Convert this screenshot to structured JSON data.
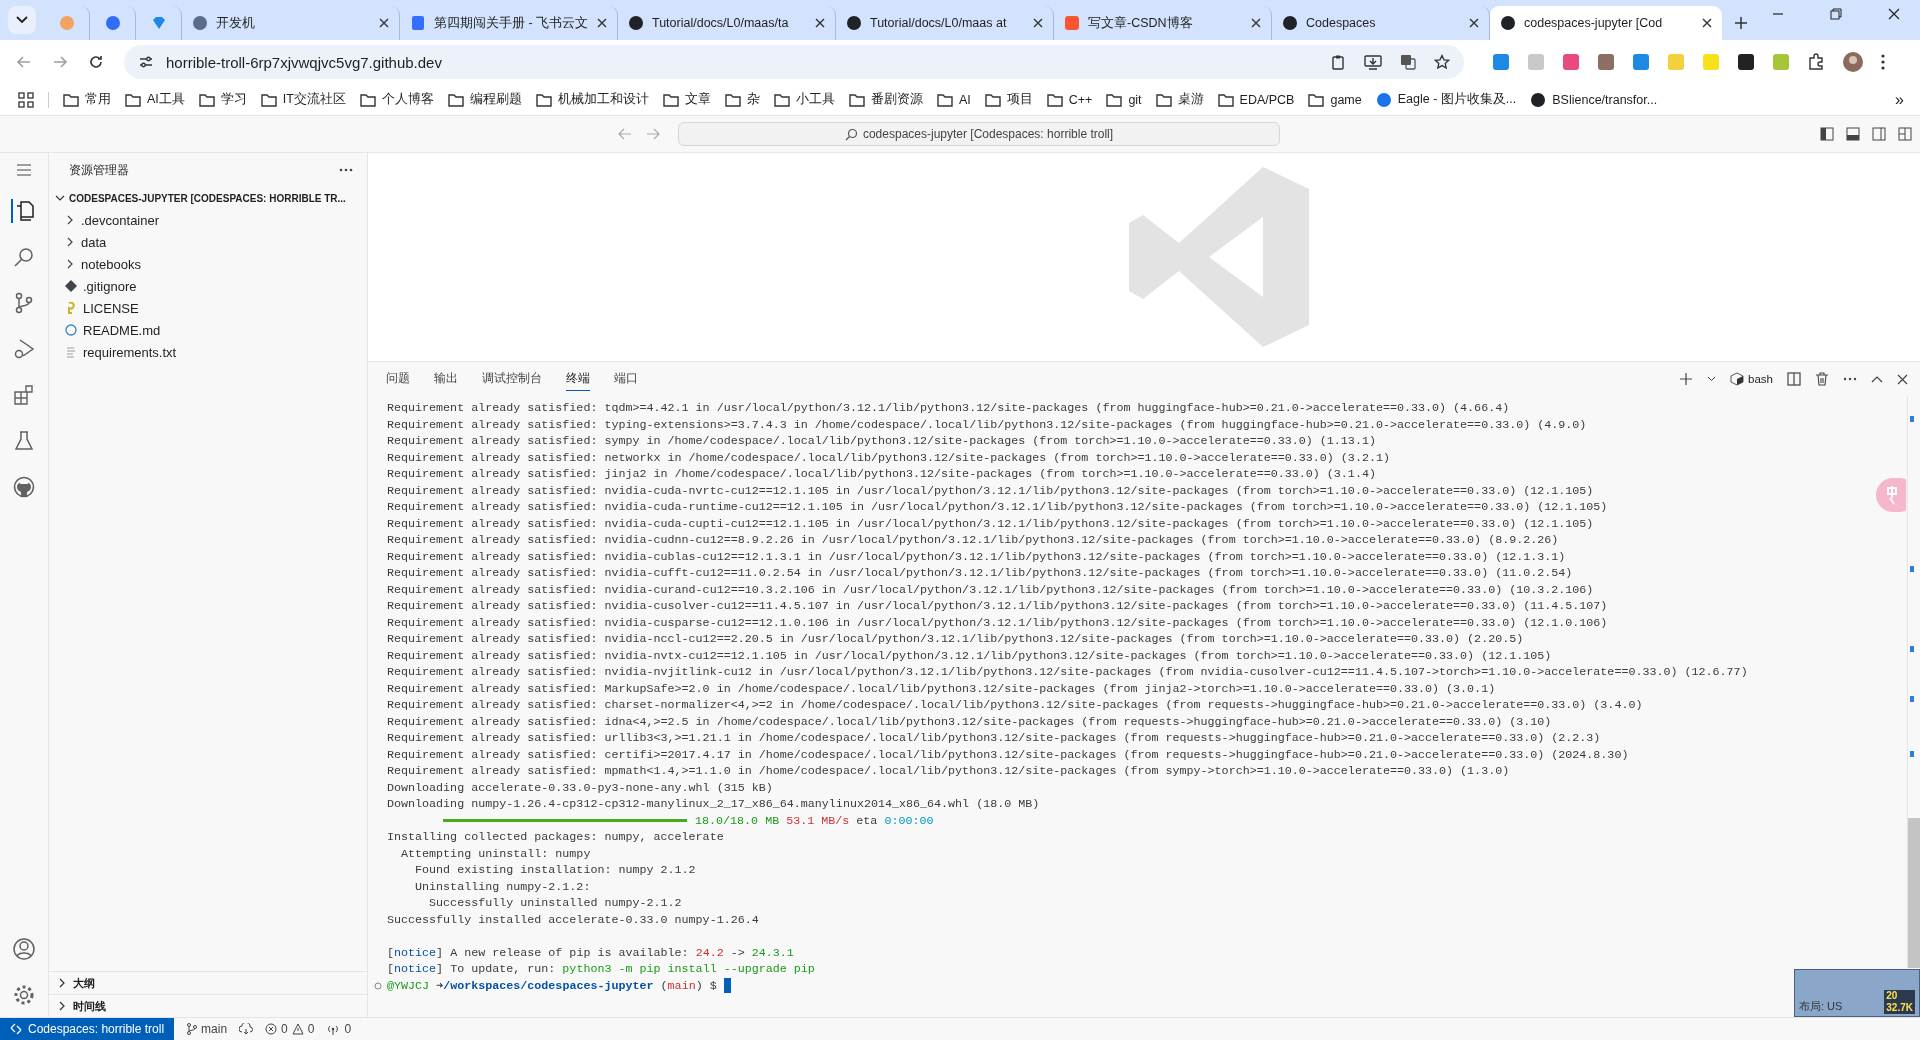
{
  "browser": {
    "tabs": [
      {
        "selected": false
      },
      {
        "selected": false
      },
      {
        "selected": false
      },
      {
        "title": "开发机",
        "selected": false
      },
      {
        "title": "第四期闯关手册 - 飞书云文",
        "selected": false
      },
      {
        "title": "Tutorial/docs/L0/maas/ta",
        "selected": false
      },
      {
        "title": "Tutorial/docs/L0/maas at",
        "selected": false
      },
      {
        "title": "写文章-CSDN博客",
        "selected": false
      },
      {
        "title": "Codespaces",
        "selected": false
      },
      {
        "title": "codespaces-jupyter [Cod",
        "selected": true
      }
    ],
    "address": "horrible-troll-6rp7xjvwqjvc5vg7.github.dev",
    "bookmarks": [
      {
        "kind": "folder",
        "label": "常用"
      },
      {
        "kind": "folder",
        "label": "AI工具"
      },
      {
        "kind": "folder",
        "label": "学习"
      },
      {
        "kind": "folder",
        "label": "IT交流社区"
      },
      {
        "kind": "folder",
        "label": "个人博客"
      },
      {
        "kind": "folder",
        "label": "编程刷题"
      },
      {
        "kind": "folder",
        "label": "机械加工和设计"
      },
      {
        "kind": "folder",
        "label": "文章"
      },
      {
        "kind": "folder",
        "label": "杂"
      },
      {
        "kind": "folder",
        "label": "小工具"
      },
      {
        "kind": "folder",
        "label": "番剧资源"
      },
      {
        "kind": "folder",
        "label": "AI"
      },
      {
        "kind": "folder",
        "label": "项目"
      },
      {
        "kind": "folder",
        "label": "C++"
      },
      {
        "kind": "folder",
        "label": "git"
      },
      {
        "kind": "folder",
        "label": "桌游"
      },
      {
        "kind": "folder",
        "label": "EDA/PCB"
      },
      {
        "kind": "folder",
        "label": "game"
      },
      {
        "kind": "link",
        "label": "Eagle - 图片收集及..."
      },
      {
        "kind": "link",
        "label": "BSlience/transfor..."
      }
    ],
    "more_bookmarks": "»"
  },
  "command_center": "codespaces-jupyter [Codespaces: horrible troll]",
  "sidebar": {
    "title": "资源管理器",
    "root": {
      "label": "CODESPACES-JUPYTER [CODESPACES: HORRIBLE TR...",
      "expanded": true,
      "children": [
        {
          "label": ".devcontainer",
          "kind": "folder",
          "expanded": false
        },
        {
          "label": "data",
          "kind": "folder",
          "expanded": false
        },
        {
          "label": "notebooks",
          "kind": "folder",
          "expanded": false
        },
        {
          "label": ".gitignore",
          "kind": "git"
        },
        {
          "label": "LICENSE",
          "kind": "license"
        },
        {
          "label": "README.md",
          "kind": "info"
        },
        {
          "label": "requirements.txt",
          "kind": "text"
        }
      ]
    },
    "sections": [
      {
        "label": "大纲",
        "expanded": false
      },
      {
        "label": "时间线",
        "expanded": false
      }
    ]
  },
  "panel": {
    "tabs": [
      {
        "label": "问题",
        "selected": false
      },
      {
        "label": "输出",
        "selected": false
      },
      {
        "label": "调试控制台",
        "selected": false
      },
      {
        "label": "终端",
        "selected": true
      },
      {
        "label": "端口",
        "selected": false
      }
    ],
    "shell": "bash",
    "lines": [
      {
        "kind": "plain",
        "text": "Requirement already satisfied: tqdm>=4.42.1 in /usr/local/python/3.12.1/lib/python3.12/site-packages (from huggingface-hub>=0.21.0->accelerate==0.33.0) (4.66.4)"
      },
      {
        "kind": "plain",
        "text": "Requirement already satisfied: typing-extensions>=3.7.4.3 in /home/codespace/.local/lib/python3.12/site-packages (from huggingface-hub>=0.21.0->accelerate==0.33.0) (4.9.0)"
      },
      {
        "kind": "plain",
        "text": "Requirement already satisfied: sympy in /home/codespace/.local/lib/python3.12/site-packages (from torch>=1.10.0->accelerate==0.33.0) (1.13.1)"
      },
      {
        "kind": "plain",
        "text": "Requirement already satisfied: networkx in /home/codespace/.local/lib/python3.12/site-packages (from torch>=1.10.0->accelerate==0.33.0) (3.2.1)"
      },
      {
        "kind": "plain",
        "text": "Requirement already satisfied: jinja2 in /home/codespace/.local/lib/python3.12/site-packages (from torch>=1.10.0->accelerate==0.33.0) (3.1.4)"
      },
      {
        "kind": "plain",
        "text": "Requirement already satisfied: nvidia-cuda-nvrtc-cu12==12.1.105 in /usr/local/python/3.12.1/lib/python3.12/site-packages (from torch>=1.10.0->accelerate==0.33.0) (12.1.105)"
      },
      {
        "kind": "plain",
        "text": "Requirement already satisfied: nvidia-cuda-runtime-cu12==12.1.105 in /usr/local/python/3.12.1/lib/python3.12/site-packages (from torch>=1.10.0->accelerate==0.33.0) (12.1.105)"
      },
      {
        "kind": "plain",
        "text": "Requirement already satisfied: nvidia-cuda-cupti-cu12==12.1.105 in /usr/local/python/3.12.1/lib/python3.12/site-packages (from torch>=1.10.0->accelerate==0.33.0) (12.1.105)"
      },
      {
        "kind": "plain",
        "text": "Requirement already satisfied: nvidia-cudnn-cu12==8.9.2.26 in /usr/local/python/3.12.1/lib/python3.12/site-packages (from torch>=1.10.0->accelerate==0.33.0) (8.9.2.26)"
      },
      {
        "kind": "plain",
        "text": "Requirement already satisfied: nvidia-cublas-cu12==12.1.3.1 in /usr/local/python/3.12.1/lib/python3.12/site-packages (from torch>=1.10.0->accelerate==0.33.0) (12.1.3.1)"
      },
      {
        "kind": "plain",
        "text": "Requirement already satisfied: nvidia-cufft-cu12==11.0.2.54 in /usr/local/python/3.12.1/lib/python3.12/site-packages (from torch>=1.10.0->accelerate==0.33.0) (11.0.2.54)"
      },
      {
        "kind": "plain",
        "text": "Requirement already satisfied: nvidia-curand-cu12==10.3.2.106 in /usr/local/python/3.12.1/lib/python3.12/site-packages (from torch>=1.10.0->accelerate==0.33.0) (10.3.2.106)"
      },
      {
        "kind": "plain",
        "text": "Requirement already satisfied: nvidia-cusolver-cu12==11.4.5.107 in /usr/local/python/3.12.1/lib/python3.12/site-packages (from torch>=1.10.0->accelerate==0.33.0) (11.4.5.107)"
      },
      {
        "kind": "plain",
        "text": "Requirement already satisfied: nvidia-cusparse-cu12==12.1.0.106 in /usr/local/python/3.12.1/lib/python3.12/site-packages (from torch>=1.10.0->accelerate==0.33.0) (12.1.0.106)"
      },
      {
        "kind": "plain",
        "text": "Requirement already satisfied: nvidia-nccl-cu12==2.20.5 in /usr/local/python/3.12.1/lib/python3.12/site-packages (from torch>=1.10.0->accelerate==0.33.0) (2.20.5)"
      },
      {
        "kind": "plain",
        "text": "Requirement already satisfied: nvidia-nvtx-cu12==12.1.105 in /usr/local/python/3.12.1/lib/python3.12/site-packages (from torch>=1.10.0->accelerate==0.33.0) (12.1.105)"
      },
      {
        "kind": "plain",
        "text": "Requirement already satisfied: nvidia-nvjitlink-cu12 in /usr/local/python/3.12.1/lib/python3.12/site-packages (from nvidia-cusolver-cu12==11.4.5.107->torch>=1.10.0->accelerate==0.33.0) (12.6.77)"
      },
      {
        "kind": "plain",
        "text": "Requirement already satisfied: MarkupSafe>=2.0 in /home/codespace/.local/lib/python3.12/site-packages (from jinja2->torch>=1.10.0->accelerate==0.33.0) (3.0.1)"
      },
      {
        "kind": "plain",
        "text": "Requirement already satisfied: charset-normalizer<4,>=2 in /home/codespace/.local/lib/python3.12/site-packages (from requests->huggingface-hub>=0.21.0->accelerate==0.33.0) (3.4.0)"
      },
      {
        "kind": "plain",
        "text": "Requirement already satisfied: idna<4,>=2.5 in /home/codespace/.local/lib/python3.12/site-packages (from requests->huggingface-hub>=0.21.0->accelerate==0.33.0) (3.10)"
      },
      {
        "kind": "plain",
        "text": "Requirement already satisfied: urllib3<3,>=1.21.1 in /home/codespace/.local/lib/python3.12/site-packages (from requests->huggingface-hub>=0.21.0->accelerate==0.33.0) (2.2.3)"
      },
      {
        "kind": "plain",
        "text": "Requirement already satisfied: certifi>=2017.4.17 in /home/codespace/.local/lib/python3.12/site-packages (from requests->huggingface-hub>=0.21.0->accelerate==0.33.0) (2024.8.30)"
      },
      {
        "kind": "plain",
        "text": "Requirement already satisfied: mpmath<1.4,>=1.1.0 in /home/codespace/.local/lib/python3.12/site-packages (from sympy->torch>=1.10.0->accelerate==0.33.0) (1.3.0)"
      },
      {
        "kind": "plain",
        "text": "Downloading accelerate-0.33.0-py3-none-any.whl (315 kB)"
      },
      {
        "kind": "plain",
        "text": "Downloading numpy-1.26.4-cp312-cp312-manylinux_2_17_x86_64.manylinux2014_x86_64.whl (18.0 MB)"
      },
      {
        "kind": "progress",
        "level": 1,
        "parts": [
          {
            "kind": "green",
            "text": "18.0/18.0 MB"
          },
          {
            "kind": "red",
            "text": " 53.1 MB/s"
          },
          {
            "kind": "plain",
            "text": " eta "
          },
          {
            "kind": "cyan",
            "text": "0:00:00"
          }
        ]
      },
      {
        "kind": "plain",
        "text": "Installing collected packages: numpy, accelerate"
      },
      {
        "kind": "plain",
        "text": "  Attempting uninstall: numpy"
      },
      {
        "kind": "plain",
        "text": "    Found existing installation: numpy 2.1.2"
      },
      {
        "kind": "plain",
        "text": "    Uninstalling numpy-2.1.2:"
      },
      {
        "kind": "plain",
        "text": "      Successfully uninstalled numpy-2.1.2"
      },
      {
        "kind": "plain",
        "text": "Successfully installed accelerate-0.33.0 numpy-1.26.4"
      },
      {
        "kind": "styled",
        "gap_before": true,
        "parts": [
          {
            "kind": "plain",
            "text": "["
          },
          {
            "kind": "blue",
            "text": "notice"
          },
          {
            "kind": "plain",
            "text": "] A new release of pip is available: "
          },
          {
            "kind": "red",
            "text": "24.2"
          },
          {
            "kind": "plain",
            "text": " -> "
          },
          {
            "kind": "green",
            "text": "24.3.1"
          }
        ]
      },
      {
        "kind": "styled",
        "parts": [
          {
            "kind": "plain",
            "text": "["
          },
          {
            "kind": "blue",
            "text": "notice"
          },
          {
            "kind": "plain",
            "text": "] To update, run: "
          },
          {
            "kind": "green",
            "text": "python3 -m pip install --upgrade pip"
          }
        ]
      },
      {
        "kind": "prompt",
        "parts": [
          {
            "kind": "green",
            "text": "@YWJCJ"
          },
          {
            "kind": "bold",
            "text": " ➜"
          },
          {
            "kind": "bold-blue",
            "text": "/workspaces/codespaces-jupyter"
          },
          {
            "kind": "plain",
            "text": " ("
          },
          {
            "kind": "red",
            "text": "main"
          },
          {
            "kind": "plain",
            "text": ") $ "
          }
        ]
      }
    ]
  },
  "status_bar": {
    "remote": "Codespaces: horrible troll",
    "branch": "main",
    "errors": "0",
    "warnings": "0",
    "ports": "0"
  },
  "input_widget": {
    "layout": "布局: US",
    "value_1": "20",
    "value_2": "32.7K"
  }
}
